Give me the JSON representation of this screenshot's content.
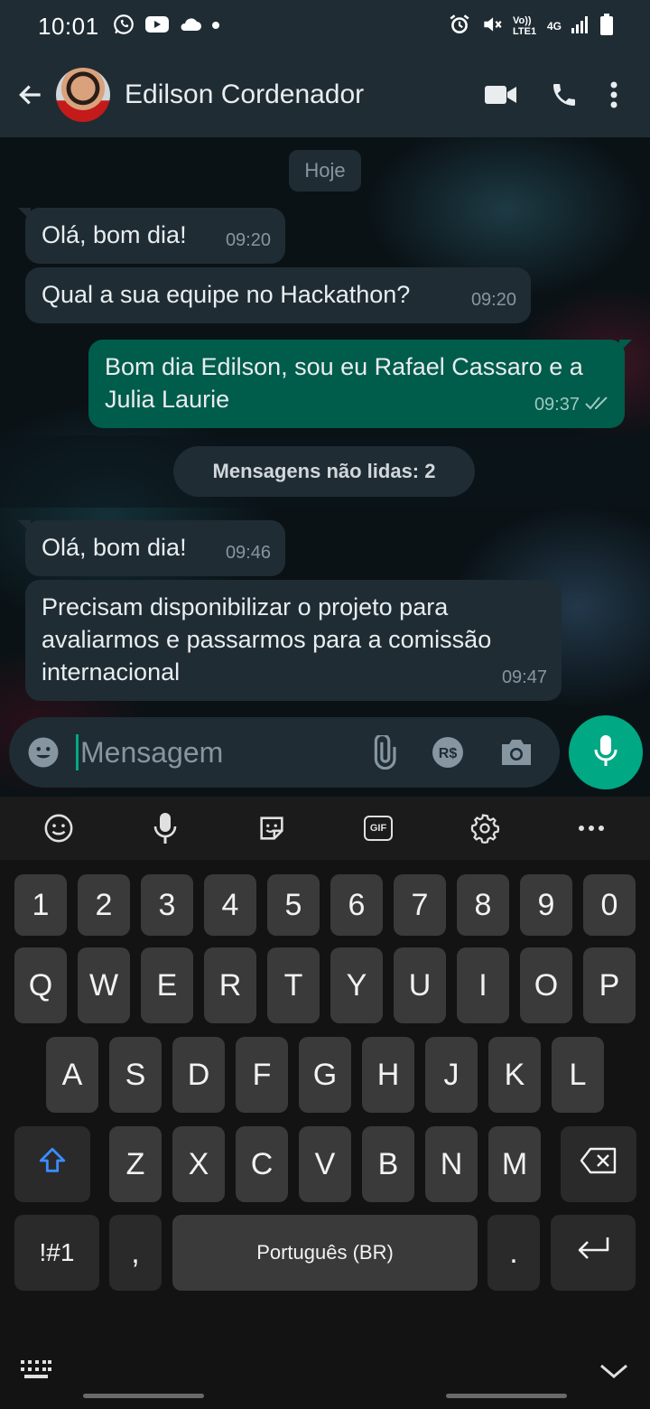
{
  "status_bar": {
    "time": "10:01",
    "network_label": "Vo)) LTE1",
    "net_type": "4G"
  },
  "header": {
    "contact_name": "Edilson Cordenador"
  },
  "chat": {
    "date_label": "Hoje",
    "messages": [
      {
        "direction": "in",
        "text": "Olá, bom dia!",
        "time": "09:20"
      },
      {
        "direction": "in",
        "text": "Qual a sua equipe no Hackathon?",
        "time": "09:20"
      },
      {
        "direction": "out",
        "text": "Bom dia Edilson, sou eu Rafael Cassaro e a Julia Laurie",
        "time": "09:37"
      },
      {
        "direction": "in",
        "text": "Olá, bom dia!",
        "time": "09:46"
      },
      {
        "direction": "in",
        "text": "Precisam disponibilizar o projeto para avaliarmos e passarmos para a comissão internacional",
        "time": "09:47"
      }
    ],
    "unread_label": "Mensagens não lidas: 2"
  },
  "composer": {
    "placeholder": "Mensagem"
  },
  "keyboard": {
    "row_numbers": [
      "1",
      "2",
      "3",
      "4",
      "5",
      "6",
      "7",
      "8",
      "9",
      "0"
    ],
    "row_1": [
      "Q",
      "W",
      "E",
      "R",
      "T",
      "Y",
      "U",
      "I",
      "O",
      "P"
    ],
    "row_2": [
      "A",
      "S",
      "D",
      "F",
      "G",
      "H",
      "J",
      "K",
      "L"
    ],
    "row_3": [
      "Z",
      "X",
      "C",
      "V",
      "B",
      "N",
      "M"
    ],
    "symbols_key": "!#1",
    "comma_key": ",",
    "space_label": "Português (BR)",
    "period_key": ".",
    "gif_label": "GIF"
  },
  "colors": {
    "accent": "#00a884",
    "outgoing_bubble": "#005c4b",
    "incoming_bubble": "#1f2c34",
    "read_ticks": "#9fc8bf"
  }
}
